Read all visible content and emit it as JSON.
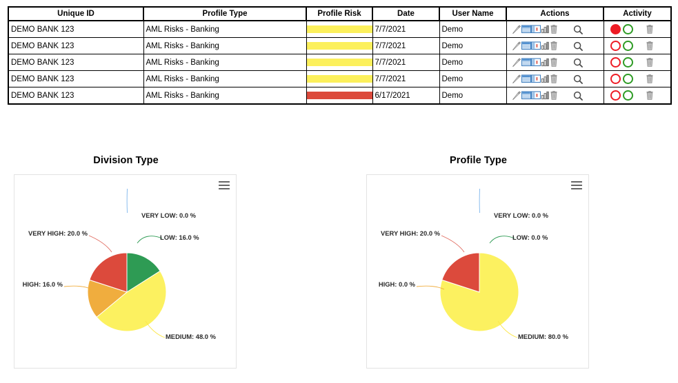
{
  "table": {
    "columns": [
      {
        "key": "unique_id",
        "label": "Unique ID"
      },
      {
        "key": "profile_type",
        "label": "Profile Type"
      },
      {
        "key": "profile_risk",
        "label": "Profile Risk"
      },
      {
        "key": "date",
        "label": "Date"
      },
      {
        "key": "user_name",
        "label": "User Name"
      },
      {
        "key": "actions",
        "label": "Actions"
      },
      {
        "key": "activity",
        "label": "Activity"
      }
    ],
    "rows": [
      {
        "unique_id": "DEMO BANK 123",
        "profile_type": "AML Risks - Banking",
        "risk_color": "#FCF05C",
        "risk_level": "MEDIUM",
        "date": "7/7/2021",
        "user_name": "Demo",
        "activity_red_filled": true
      },
      {
        "unique_id": "DEMO BANK 123",
        "profile_type": "AML Risks - Banking",
        "risk_color": "#FCF05C",
        "risk_level": "MEDIUM",
        "date": "7/7/2021",
        "user_name": "Demo",
        "activity_red_filled": false
      },
      {
        "unique_id": "DEMO BANK 123",
        "profile_type": "AML Risks - Banking",
        "risk_color": "#FCF05C",
        "risk_level": "MEDIUM",
        "date": "7/7/2021",
        "user_name": "Demo",
        "activity_red_filled": false
      },
      {
        "unique_id": "DEMO BANK 123",
        "profile_type": "AML Risks - Banking",
        "risk_color": "#FCF05C",
        "risk_level": "MEDIUM",
        "date": "7/7/2021",
        "user_name": "Demo",
        "activity_red_filled": false
      },
      {
        "unique_id": "DEMO BANK 123",
        "profile_type": "AML Risks - Banking",
        "risk_color": "#DC4A3C",
        "risk_level": "VERY HIGH",
        "date": "6/17/2021",
        "user_name": "Demo",
        "activity_red_filled": false
      }
    ],
    "action_icons": [
      "pencil-icon",
      "table-view-icon",
      "document-view-icon",
      "bar-chart-icon",
      "trash-icon",
      "magnifier-icon"
    ],
    "activity_icons": [
      "red-status-circle",
      "green-status-circle",
      "trash-icon"
    ]
  },
  "charts": {
    "menu_icon": "hamburger-menu-icon",
    "palette": {
      "very_low": "#7CB5EC",
      "low": "#2E9B54",
      "medium": "#FCF160",
      "high": "#F0AD3E",
      "very_high": "#DC4A3C"
    }
  },
  "chart_data": [
    {
      "id": "division-type",
      "type": "pie",
      "title": "Division Type",
      "labels": [
        "VERY LOW",
        "LOW",
        "MEDIUM",
        "HIGH",
        "VERY HIGH"
      ],
      "values": [
        0.0,
        16.0,
        48.0,
        16.0,
        20.0
      ],
      "unit": "%",
      "colors": [
        "#7CB5EC",
        "#2E9B54",
        "#FCF160",
        "#F0AD3E",
        "#DC4A3C"
      ],
      "annotations": [
        "VERY LOW: 0.0 %",
        "LOW: 16.0 %",
        "MEDIUM: 48.0 %",
        "HIGH: 16.0 %",
        "VERY HIGH: 20.0 %"
      ],
      "legend": "none",
      "grid": false
    },
    {
      "id": "profile-type",
      "type": "pie",
      "title": "Profile Type",
      "labels": [
        "VERY LOW",
        "LOW",
        "MEDIUM",
        "HIGH",
        "VERY HIGH"
      ],
      "values": [
        0.0,
        0.0,
        80.0,
        0.0,
        20.0
      ],
      "unit": "%",
      "colors": [
        "#7CB5EC",
        "#2E9B54",
        "#FCF160",
        "#F0AD3E",
        "#DC4A3C"
      ],
      "annotations": [
        "VERY LOW: 0.0 %",
        "LOW: 0.0 %",
        "MEDIUM: 80.0 %",
        "HIGH: 0.0 %",
        "VERY HIGH: 20.0 %"
      ],
      "legend": "none",
      "grid": false
    }
  ]
}
